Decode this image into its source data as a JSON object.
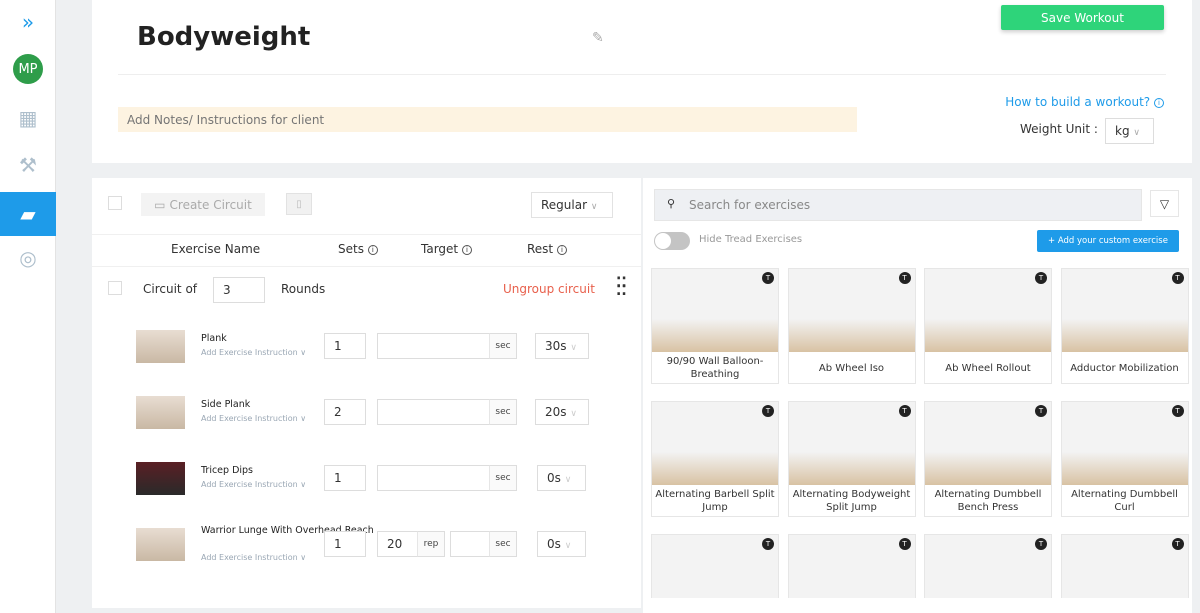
{
  "sidebar": {
    "avatar": "MP",
    "items": [
      "expand",
      "dashboard",
      "exercises",
      "workouts",
      "support"
    ]
  },
  "header": {
    "title": "Bodyweight",
    "save_label": "Save Workout",
    "notes_placeholder": "Add Notes/ Instructions for client",
    "how_to": "How to build a workout?",
    "weight_unit_label": "Weight Unit :",
    "weight_unit": "kg"
  },
  "builder": {
    "create_circuit": "Create Circuit",
    "mode": "Regular",
    "columns": {
      "name": "Exercise Name",
      "sets": "Sets",
      "target": "Target",
      "rest": "Rest"
    },
    "circuit": {
      "prefix": "Circuit of",
      "rounds": "3",
      "suffix": "Rounds",
      "ungroup": "Ungroup circuit"
    },
    "add_instruction": "Add Exercise Instruction ∨",
    "exercises": [
      {
        "name": "Plank",
        "sets": "1",
        "target": "",
        "unit": "sec",
        "rest": "30s"
      },
      {
        "name": "Side Plank",
        "sets": "2",
        "target": "",
        "unit": "sec",
        "rest": "20s"
      },
      {
        "name": "Tricep Dips",
        "sets": "1",
        "target": "",
        "unit": "sec",
        "rest": "0s"
      },
      {
        "name": "Warrior Lunge With Overhead Reach",
        "sets": "1",
        "reps": "20",
        "rep_unit": "rep",
        "target": "",
        "unit": "sec",
        "rest": "0s"
      }
    ]
  },
  "library": {
    "search_placeholder": "Search for exercises",
    "hide_tread": "Hide Tread Exercises",
    "add_custom": "+ Add your custom exercise",
    "badge": "T",
    "cards": [
      "90/90 Wall Balloon-Breathing",
      "Ab Wheel Iso",
      "Ab Wheel Rollout",
      "Adductor Mobilization",
      "Alternating Barbell Split Jump",
      "Alternating Bodyweight Split Jump",
      "Alternating Dumbbell Bench Press",
      "Alternating Dumbbell Curl",
      "",
      "",
      "",
      ""
    ]
  },
  "colors": {
    "primary": "#1e9be9",
    "save": "#2ed47a",
    "ungroup": "#e8604c"
  }
}
